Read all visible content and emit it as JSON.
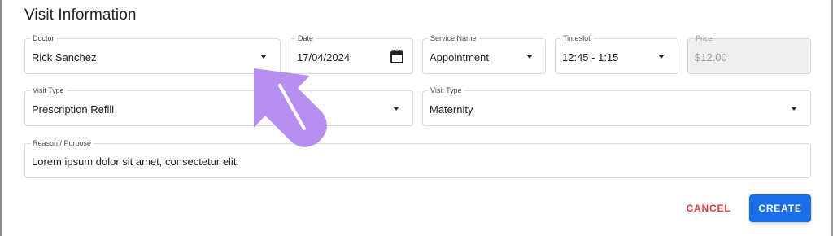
{
  "dialog": {
    "title": "Visit Information"
  },
  "fields": {
    "doctor": {
      "label": "Doctor",
      "value": "Rick Sanchez"
    },
    "date": {
      "label": "Date",
      "value": "17/04/2024"
    },
    "service": {
      "label": "Service Name",
      "value": "Appointment"
    },
    "timeslot": {
      "label": "Timeslot",
      "value": "12:45 - 1:15"
    },
    "price": {
      "label": "Price",
      "value": "$12.00"
    },
    "visit_type_1": {
      "label": "Visit Type",
      "value": "Prescription Refill"
    },
    "visit_type_2": {
      "label": "Visit Type",
      "value": "Maternity"
    },
    "reason": {
      "label": "Reason / Purpose",
      "value": "Lorem ipsum dolor sit amet, consectetur elit."
    }
  },
  "actions": {
    "cancel": "CANCEL",
    "create": "CREATE"
  },
  "icons": {
    "dropdown": "caret-down-icon",
    "calendar": "calendar-icon",
    "pointer": "pointer-arrow-icon"
  },
  "colors": {
    "primary": "#1a6fe8",
    "cancel": "#e53935",
    "pointer": "#b68ef0",
    "disabled_bg": "#efefef"
  }
}
